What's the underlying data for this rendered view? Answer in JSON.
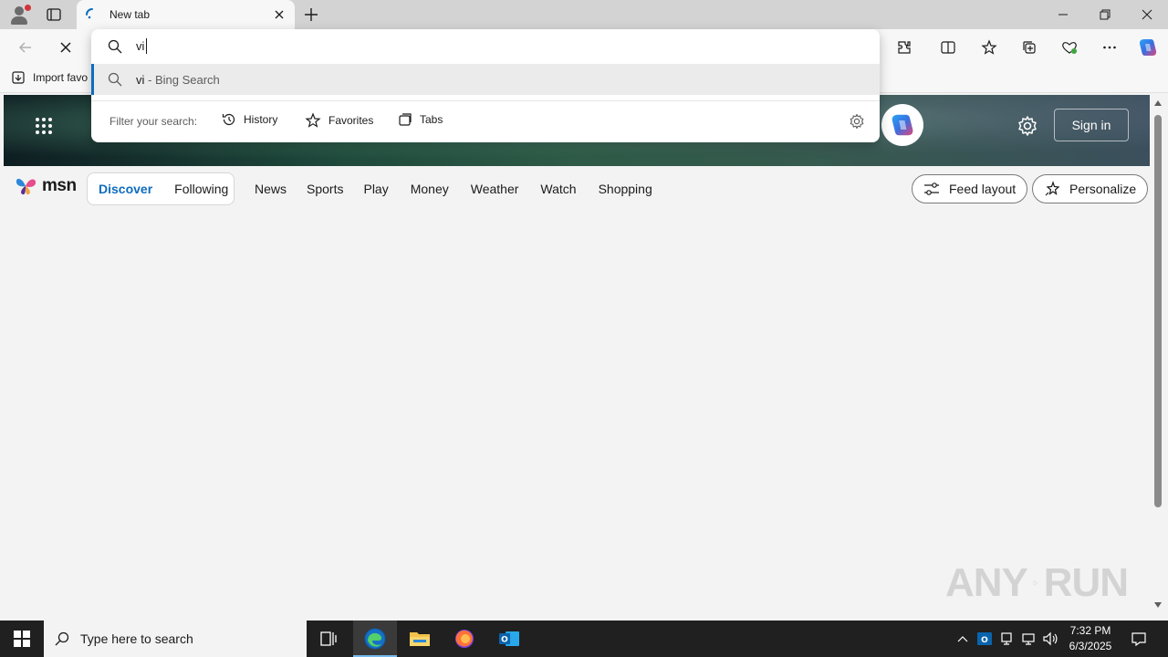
{
  "browser": {
    "tab_title": "New tab",
    "favorites_bar_item": "Import favo"
  },
  "omnibox": {
    "query": "vi",
    "suggestion_main": "vi",
    "suggestion_sub": " - Bing Search",
    "filter_label": "Filter your search:",
    "filters": [
      "History",
      "Favorites",
      "Tabs"
    ]
  },
  "msn": {
    "logo_text": "msn",
    "segments": [
      "Discover",
      "Following"
    ],
    "nav_links": [
      "News",
      "Sports",
      "Play",
      "Money",
      "Weather",
      "Watch",
      "Shopping"
    ],
    "feed_layout_label": "Feed layout",
    "personalize_label": "Personalize",
    "sign_in_label": "Sign in"
  },
  "watermark": {
    "text": "ANY",
    "text2": "RUN"
  },
  "taskbar": {
    "search_placeholder": "Type here to search",
    "time": "7:32 PM",
    "date": "6/3/2025"
  },
  "colors": {
    "accent": "#0f6cbd",
    "taskbar": "#202020"
  }
}
